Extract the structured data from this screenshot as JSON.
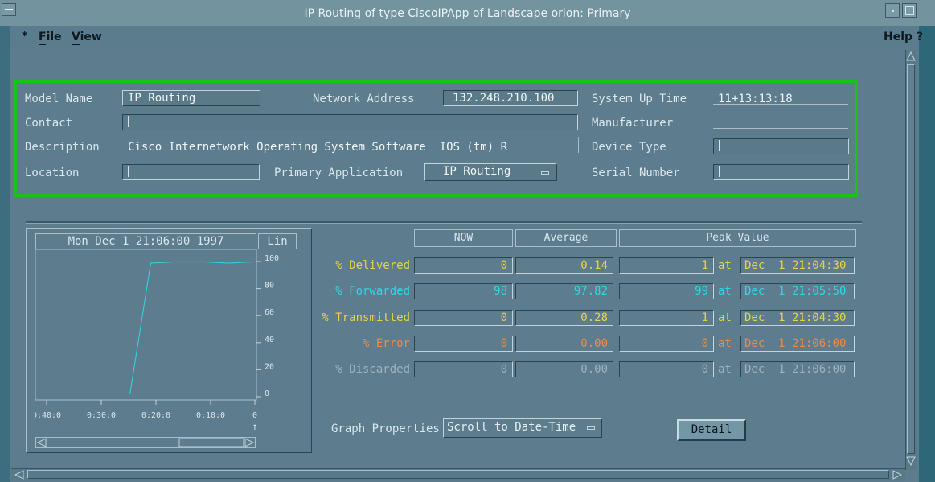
{
  "window": {
    "title": "IP Routing of type CiscoIPApp of Landscape orion: Primary"
  },
  "menu": {
    "marker": "*",
    "items": [
      "File",
      "View"
    ],
    "help": "Help ?"
  },
  "info": {
    "model_name_label": "Model Name",
    "model_name": "IP Routing",
    "network_address_label": "Network Address",
    "network_address": "132.248.210.100",
    "system_up_time_label": "System Up Time",
    "system_up_time": "11+13:13:18",
    "contact_label": "Contact",
    "contact": "",
    "manufacturer_label": "Manufacturer",
    "manufacturer": "",
    "description_label": "Description",
    "description": "Cisco Internetwork Operating System Software  IOS (tm) R",
    "device_type_label": "Device Type",
    "device_type": "",
    "location_label": "Location",
    "location": "",
    "primary_application_label": "Primary Application",
    "primary_application": "IP Routing",
    "serial_number_label": "Serial Number",
    "serial_number": ""
  },
  "graph": {
    "date": "Mon Dec  1 21:06:00 1997",
    "scale": "Lin",
    "y_ticks": [
      "100",
      "80",
      "60",
      "40",
      "20",
      "0"
    ],
    "x_ticks": [
      "0:40:0",
      "0:30:0",
      "0:20:0",
      "0:10:0",
      "0"
    ],
    "now_marker": "↑",
    "series_color": "#31d6e6"
  },
  "chart_data": {
    "type": "line",
    "title": "",
    "xlabel": "",
    "ylabel": "",
    "ylim": [
      0,
      100
    ],
    "series": [
      {
        "name": "% Forwarded",
        "x": [
          "0:40:0",
          "0:30:0",
          "0:25:0",
          "0:24:0",
          "0:20:0",
          "0:15:0",
          "0:10:0",
          "0:05:0",
          "0"
        ],
        "values": [
          null,
          null,
          null,
          0,
          97,
          98,
          98,
          97,
          98
        ]
      }
    ]
  },
  "stats": {
    "headers": [
      "NOW",
      "Average",
      "Peak Value"
    ],
    "at_label": "at",
    "rows": [
      {
        "label": "% Delivered",
        "now": "0",
        "average": "0.14",
        "peak": "1",
        "peak_time": "Dec  1 21:04:30",
        "color": "#e7d24a"
      },
      {
        "label": "% Forwarded",
        "now": "98",
        "average": "97.82",
        "peak": "99",
        "peak_time": "Dec  1 21:05:50",
        "color": "#31d6e6"
      },
      {
        "label": "% Transmitted",
        "now": "0",
        "average": "0.28",
        "peak": "1",
        "peak_time": "Dec  1 21:04:30",
        "color": "#e7d24a"
      },
      {
        "label": "% Error",
        "now": "0",
        "average": "0.00",
        "peak": "0",
        "peak_time": "Dec  1 21:06:00",
        "color": "#ee8a45"
      },
      {
        "label": "% Discarded",
        "now": "0",
        "average": "0.00",
        "peak": "0",
        "peak_time": "Dec  1 21:06:00",
        "color": "#9fb2bb"
      }
    ]
  },
  "controls": {
    "graph_properties_label": "Graph Properties",
    "graph_properties_value": "Scroll to Date-Time",
    "detail_button": "Detail"
  }
}
